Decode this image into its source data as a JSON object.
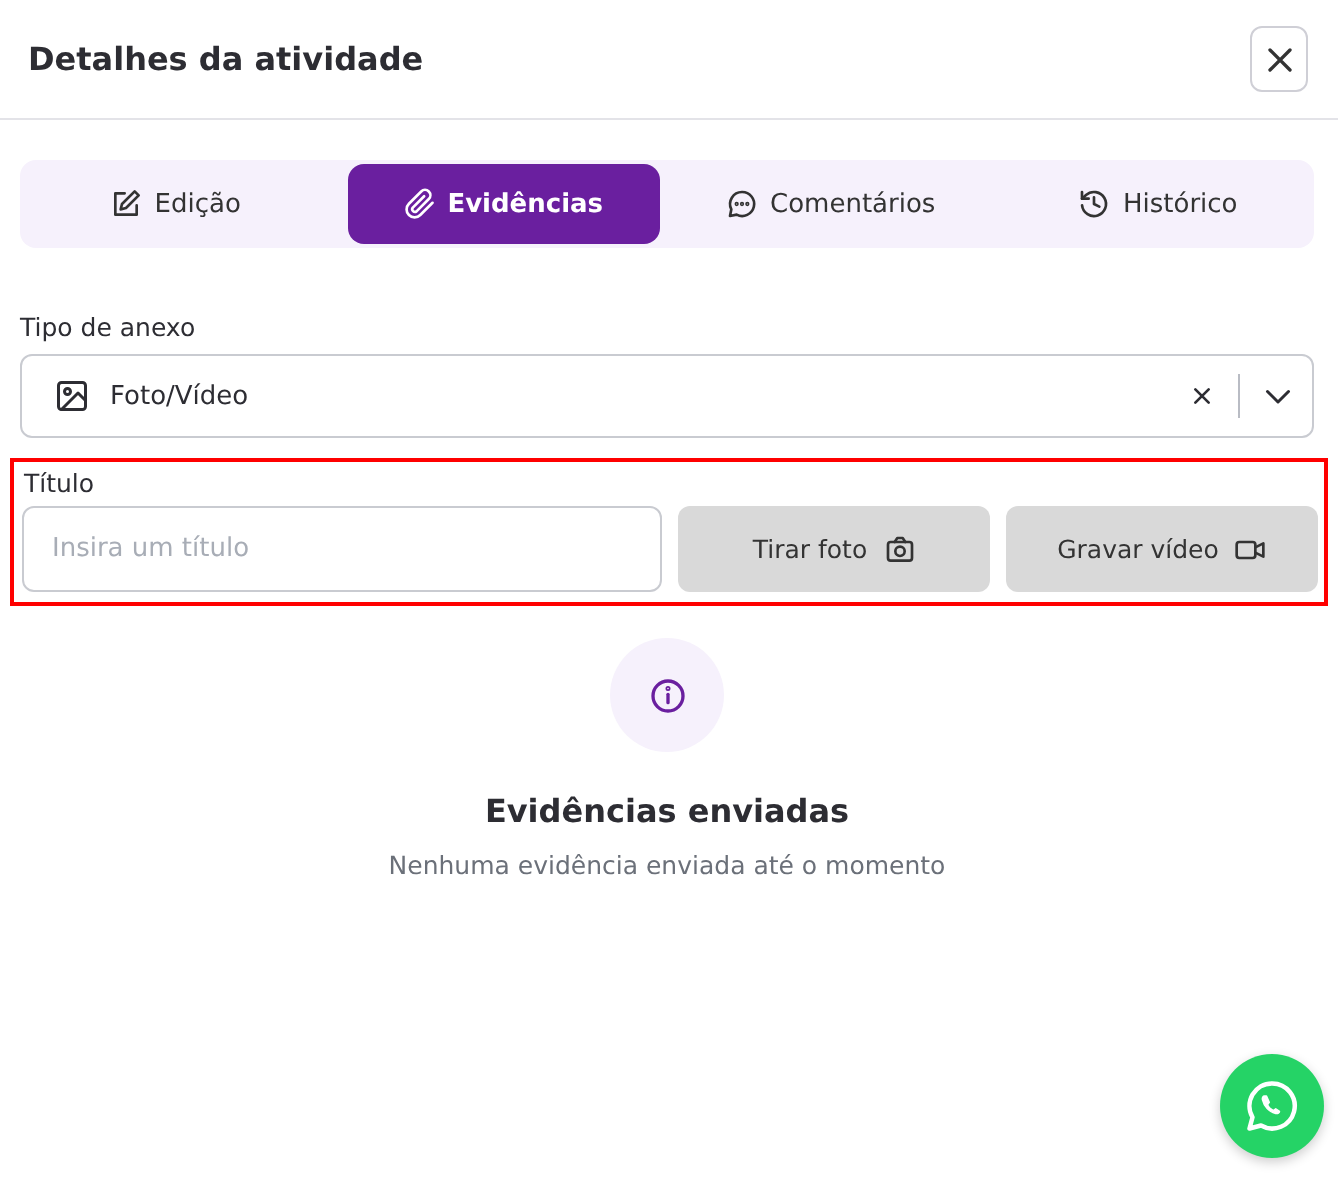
{
  "header": {
    "title": "Detalhes da atividade"
  },
  "tabs": [
    {
      "label": "Edição",
      "kind": "edit",
      "selected": false
    },
    {
      "label": "Evidências",
      "kind": "attach",
      "selected": true
    },
    {
      "label": "Comentários",
      "kind": "chat",
      "selected": false
    },
    {
      "label": "Histórico",
      "kind": "history",
      "selected": false
    }
  ],
  "attachment_type": {
    "label": "Tipo de anexo",
    "value": "Foto/Vídeo"
  },
  "title_section": {
    "highlighted": true,
    "label": "Título",
    "placeholder": "Insira um título",
    "buttons": [
      {
        "label": "Tirar foto",
        "kind": "camera"
      },
      {
        "label": "Gravar vídeo",
        "kind": "video"
      }
    ]
  },
  "empty_state": {
    "title": "Evidências enviadas",
    "message": "Nenhuma evidência enviada até o momento"
  }
}
